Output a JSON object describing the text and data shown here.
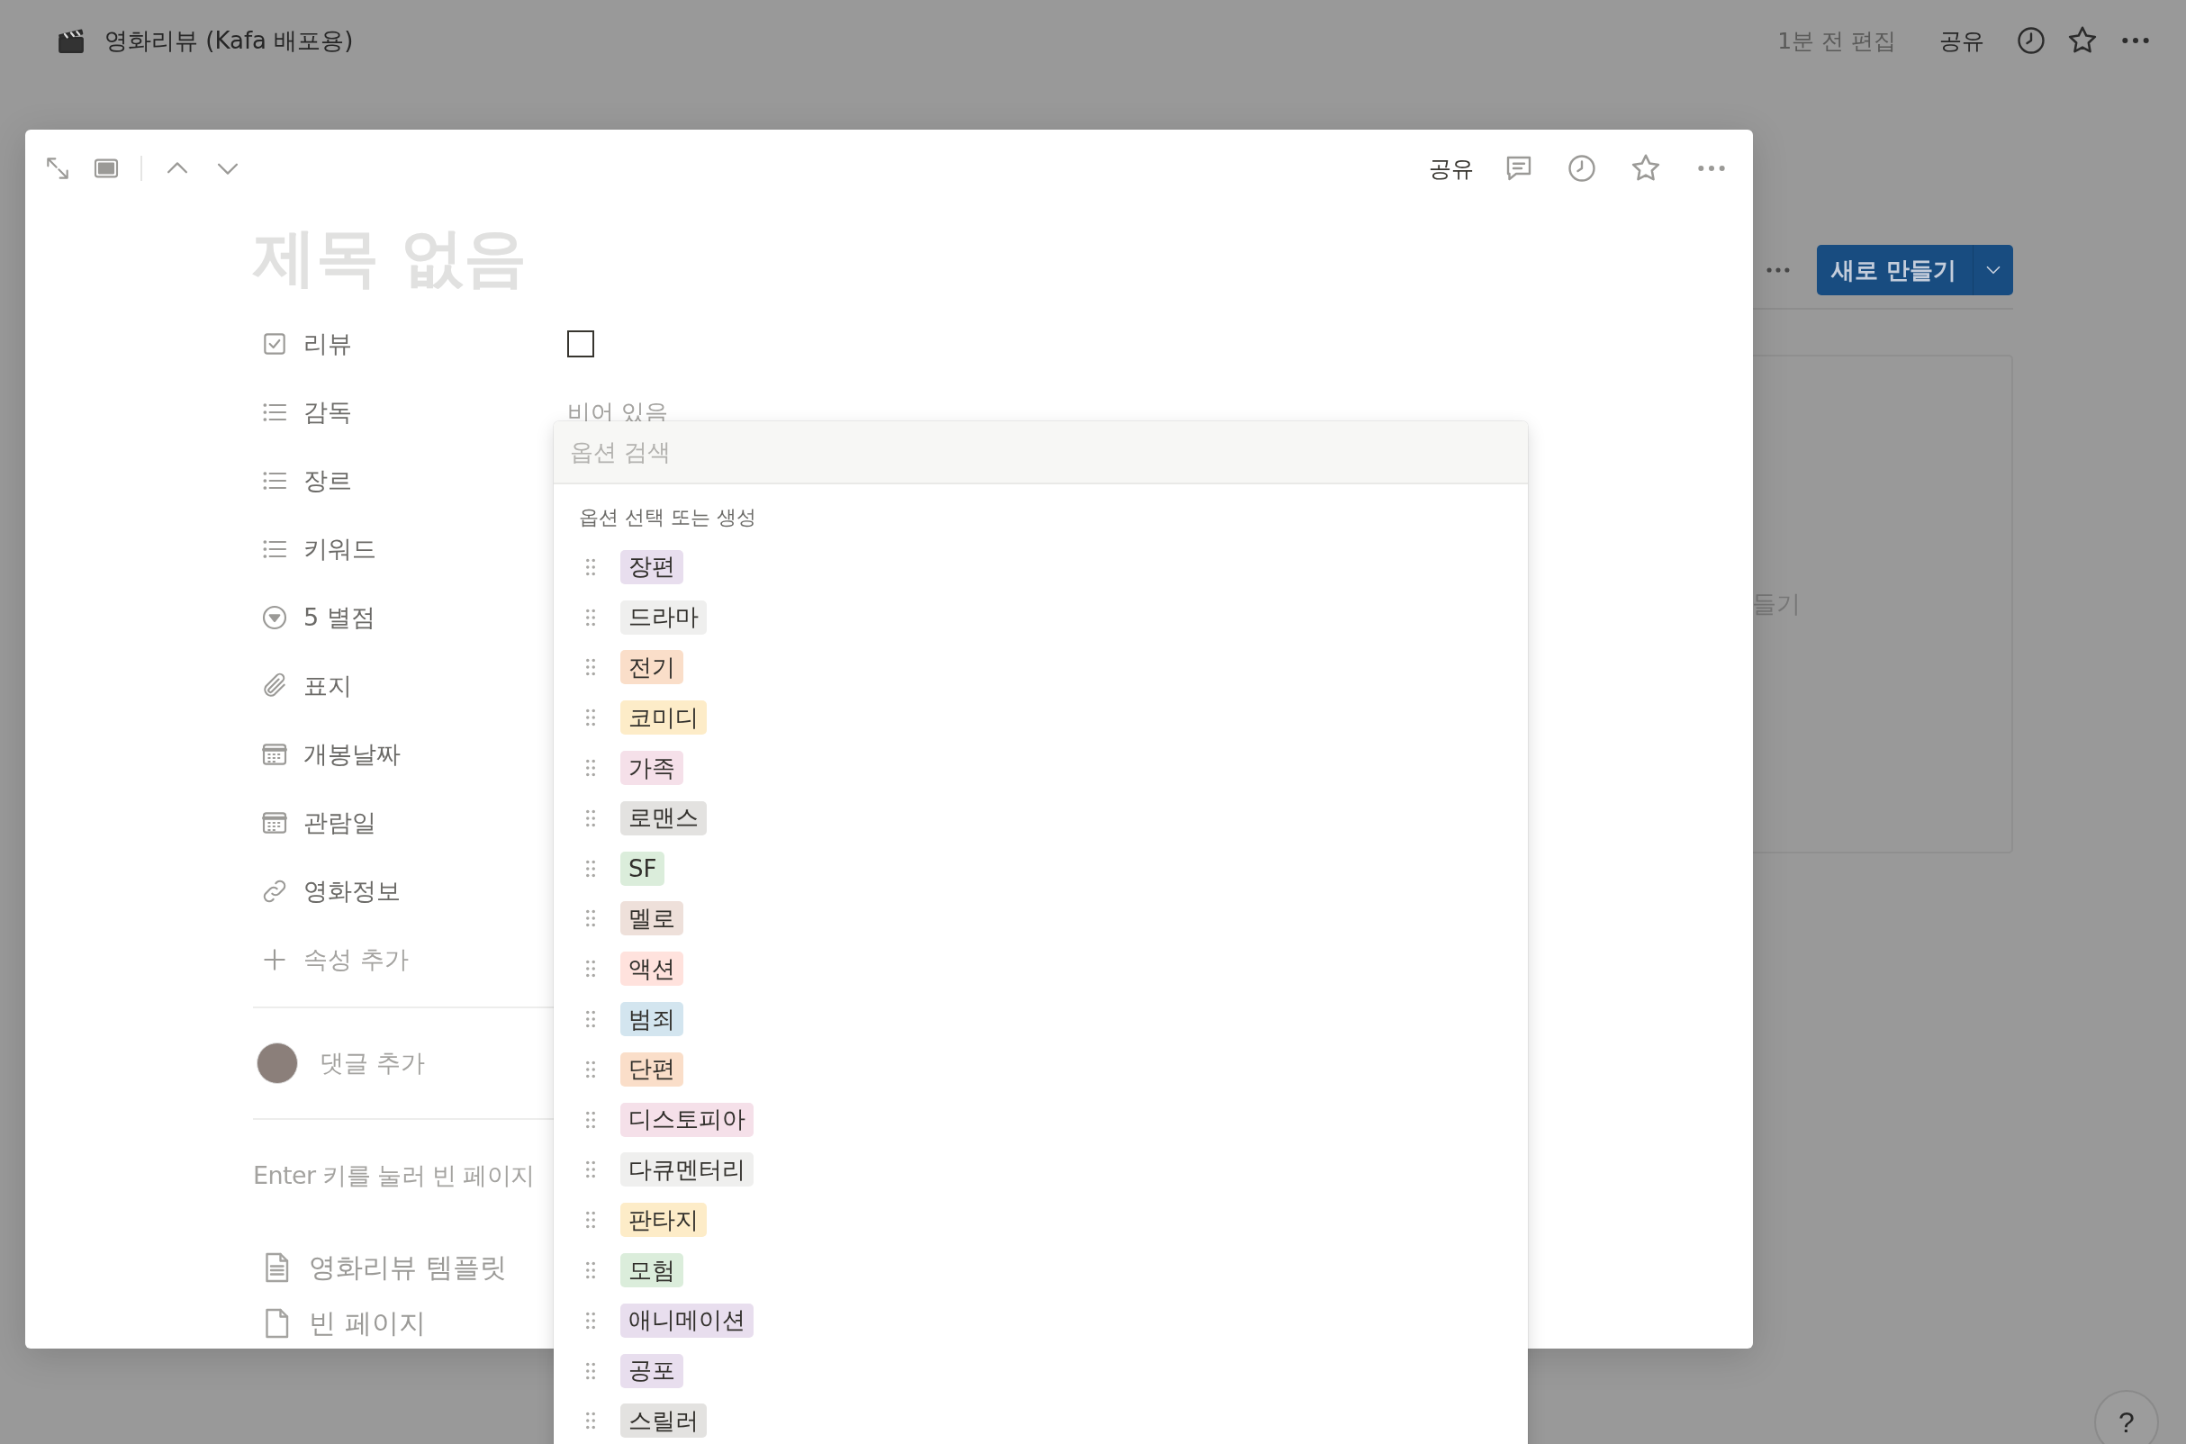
{
  "topbar": {
    "title": "영화리뷰 (Kafa 배포용)",
    "edited": "1분 전 편집",
    "share": "공유"
  },
  "board": {
    "new_button": "새로 만들기",
    "card_text": "들기"
  },
  "help": "?",
  "modal": {
    "share": "공유",
    "title_placeholder": "제목 없음",
    "properties": [
      {
        "kind": "checkbox",
        "name": "리뷰",
        "checked": false
      },
      {
        "kind": "multi_select",
        "name": "감독",
        "value_placeholder": "비어 있음"
      },
      {
        "kind": "multi_select",
        "name": "장르"
      },
      {
        "kind": "multi_select",
        "name": "키워드"
      },
      {
        "kind": "select",
        "name": "5 별점"
      },
      {
        "kind": "files",
        "name": "표지"
      },
      {
        "kind": "date",
        "name": "개봉날짜"
      },
      {
        "kind": "date",
        "name": "관람일"
      },
      {
        "kind": "url",
        "name": "영화정보"
      }
    ],
    "add_property": "속성 추가",
    "comment_placeholder": "댓글 추가",
    "empty_hint": "Enter 키를 눌러 빈 페이지",
    "templates": [
      {
        "kind": "template",
        "label": "영화리뷰 템플릿"
      },
      {
        "kind": "blank",
        "label": "빈 페이지"
      }
    ]
  },
  "dropdown": {
    "search_placeholder": "옵션 검색",
    "heading": "옵션 선택 또는 생성",
    "options": [
      {
        "label": "장편",
        "color": "#e8deee"
      },
      {
        "label": "드라마",
        "color": "#efefee"
      },
      {
        "label": "전기",
        "color": "#fadec9"
      },
      {
        "label": "코미디",
        "color": "#fdecc8"
      },
      {
        "label": "가족",
        "color": "#f5e0e9"
      },
      {
        "label": "로맨스",
        "color": "#e3e2e0"
      },
      {
        "label": "SF",
        "color": "#dbeddb"
      },
      {
        "label": "멜로",
        "color": "#eee0da"
      },
      {
        "label": "액션",
        "color": "#ffe2dd"
      },
      {
        "label": "범죄",
        "color": "#d3e5ef"
      },
      {
        "label": "단편",
        "color": "#fadec9"
      },
      {
        "label": "디스토피아",
        "color": "#f5e0e9"
      },
      {
        "label": "다큐멘터리",
        "color": "#efefee"
      },
      {
        "label": "판타지",
        "color": "#fdecc8"
      },
      {
        "label": "모험",
        "color": "#dbeddb"
      },
      {
        "label": "애니메이션",
        "color": "#e8deee"
      },
      {
        "label": "공포",
        "color": "#e8deee"
      },
      {
        "label": "스릴러",
        "color": "#e3e2e0"
      }
    ]
  }
}
